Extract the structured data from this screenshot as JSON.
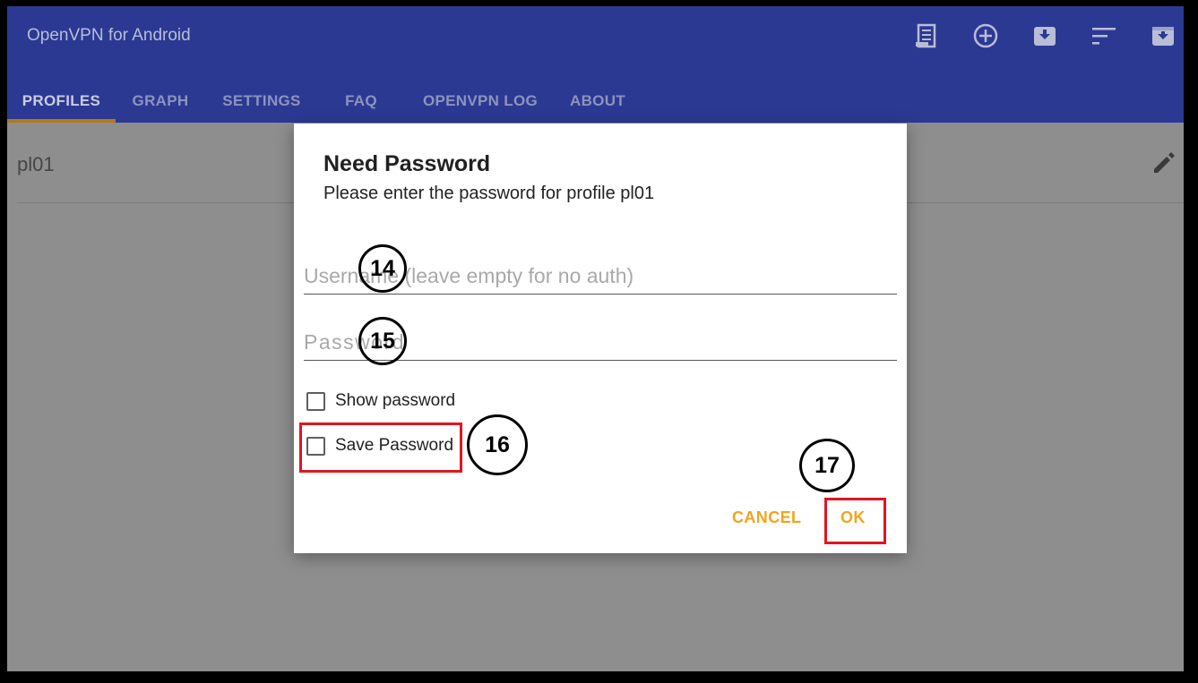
{
  "app": {
    "title": "OpenVPN for Android"
  },
  "toolbar": {
    "icons": [
      "log-icon",
      "add-circle-icon",
      "import-icon",
      "sort-icon",
      "archive-icon"
    ]
  },
  "tabs": [
    {
      "label": "PROFILES",
      "active": true
    },
    {
      "label": "GRAPH",
      "active": false
    },
    {
      "label": "SETTINGS",
      "active": false
    },
    {
      "label": "FAQ",
      "active": false
    },
    {
      "label": "OPENVPN LOG",
      "active": false
    },
    {
      "label": "ABOUT",
      "active": false
    }
  ],
  "profiles": [
    {
      "name": "pl01"
    }
  ],
  "dialog": {
    "title": "Need Password",
    "message": "Please enter the password for profile pl01",
    "username_placeholder": "Username (leave empty for no auth)",
    "username_value": "",
    "password_placeholder": "Password",
    "password_value": "",
    "show_password_label": "Show password",
    "show_password_checked": false,
    "save_password_label": "Save Password",
    "save_password_checked": false,
    "cancel_label": "CANCEL",
    "ok_label": "OK"
  },
  "annotations": {
    "markers": [
      "14",
      "15",
      "16",
      "17"
    ]
  },
  "colors": {
    "appbar": "#2b3993",
    "tab_indicator": "#b37a17",
    "dialog_button": "#f3a41c",
    "annotation_box": "#e0151f"
  }
}
